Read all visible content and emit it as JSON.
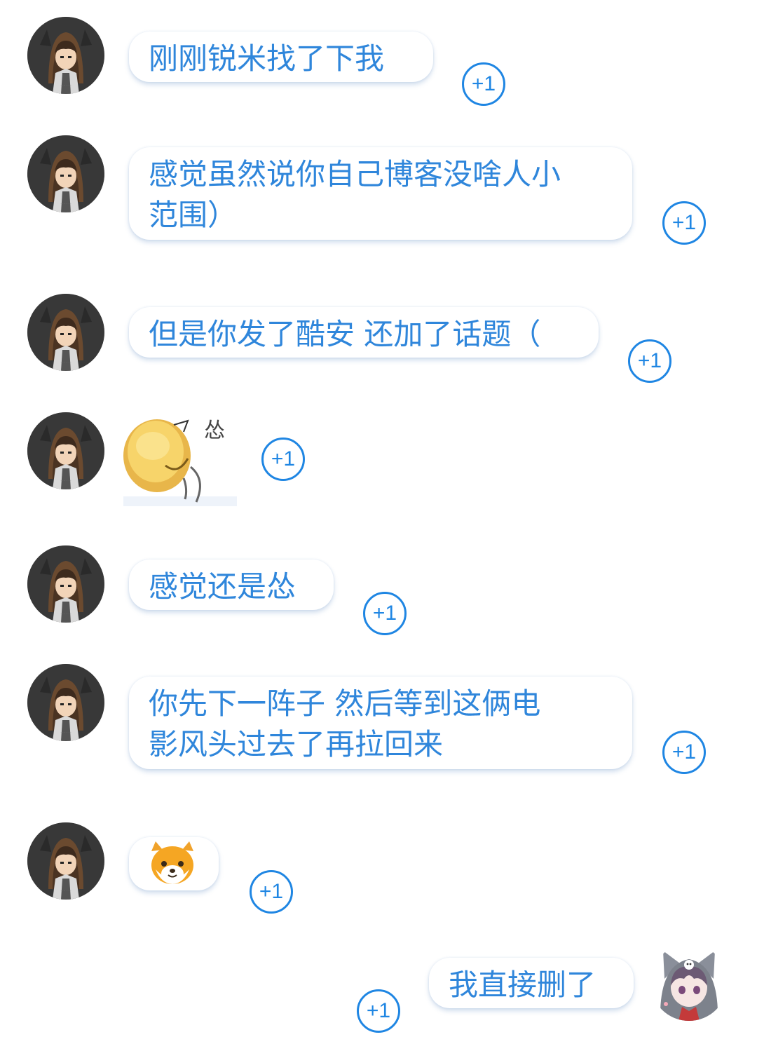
{
  "messages": [
    {
      "text": "刚刚锐米找了下我"
    },
    {
      "line1": "感觉虽然说你自己博客没啥人小",
      "line2": "范围）"
    },
    {
      "text": "但是你发了酷安 还加了话题（"
    },
    {
      "sticker_caption": "怂",
      "sticker_name": "smiling-ball-sticker"
    },
    {
      "text": "感觉还是怂"
    },
    {
      "line1": "你先下一阵子 然后等到这俩电",
      "line2": "影风头过去了再拉回来"
    },
    {
      "emoji_name": "shiba-dog-emoji"
    },
    {
      "text": "我直接删了"
    }
  ],
  "plus_one_label": "+1",
  "colors": {
    "bubble_text": "#2f86db",
    "plus_one": "#1f86e3",
    "background": "#ffffff"
  },
  "icons": {
    "sender_avatar": "hooded-boy-avatar",
    "self_avatar": "wolf-hood-girl-avatar"
  }
}
